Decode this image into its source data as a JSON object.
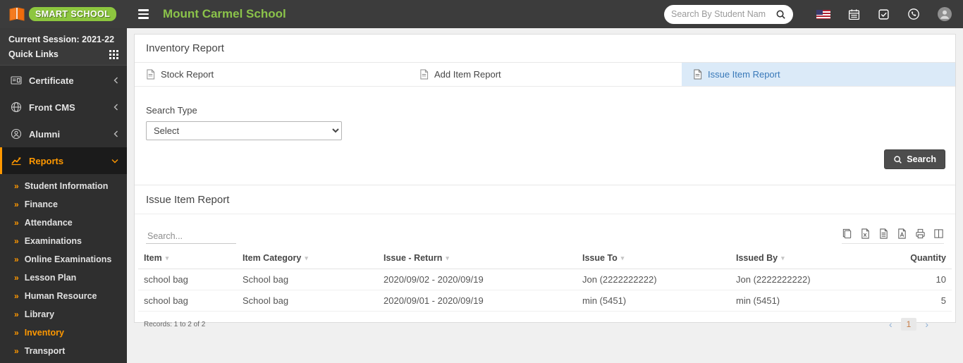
{
  "header": {
    "brand": "SMART SCHOOL",
    "school_name": "Mount Carmel School",
    "search_placeholder": "Search By Student Nam",
    "icons": [
      "search-icon",
      "us-flag-icon",
      "calendar-icon",
      "tasks-icon",
      "whatsapp-icon",
      "profile-avatar"
    ]
  },
  "sidebar": {
    "session_label": "Current Session: 2021-22",
    "quick_links_label": "Quick Links",
    "menu": [
      {
        "label": "Certificate",
        "icon": "id-card-icon"
      },
      {
        "label": "Front CMS",
        "icon": "globe-icon"
      },
      {
        "label": "Alumni",
        "icon": "user-circle-icon"
      },
      {
        "label": "Reports",
        "icon": "chart-line-icon",
        "active": true
      }
    ],
    "submenu": [
      "Student Information",
      "Finance",
      "Attendance",
      "Examinations",
      "Online Examinations",
      "Lesson Plan",
      "Human Resource",
      "Library",
      "Inventory",
      "Transport"
    ],
    "active_submenu": "Inventory"
  },
  "main": {
    "page_title": "Inventory Report",
    "tabs": [
      {
        "label": "Stock Report"
      },
      {
        "label": "Add Item Report"
      },
      {
        "label": "Issue Item Report",
        "active": true
      }
    ],
    "search_type_label": "Search Type",
    "search_type_value": "Select",
    "search_button_label": "Search",
    "section_title": "Issue Item Report",
    "table_search_placeholder": "Search...",
    "export_icons": [
      "copy-icon",
      "excel-icon",
      "csv-icon",
      "pdf-icon",
      "print-icon",
      "columns-icon"
    ],
    "table": {
      "headers": [
        "Item",
        "Item Category",
        "Issue - Return",
        "Issue To",
        "Issued By",
        "Quantity"
      ],
      "rows": [
        [
          "school bag",
          "School bag",
          "2020/09/02 - 2020/09/19",
          "Jon (2222222222)",
          "Jon (2222222222)",
          "10"
        ],
        [
          "school bag",
          "School bag",
          "2020/09/01 - 2020/09/19",
          "min (5451)",
          "min (5451)",
          "5"
        ]
      ],
      "records_text": "Records: 1 to 2 of 2"
    },
    "pagination": {
      "prev": "‹",
      "page": "1",
      "next": "›"
    }
  },
  "colors": {
    "accent_orange": "#ff9800",
    "brand_green": "#8dc63f",
    "title_green": "#8bc34a",
    "active_tab_bg": "#dbeaf8",
    "active_tab_text": "#3878b8",
    "topbar_bg": "#3c3c3c",
    "sidebar_bg": "#2f2f2f"
  }
}
